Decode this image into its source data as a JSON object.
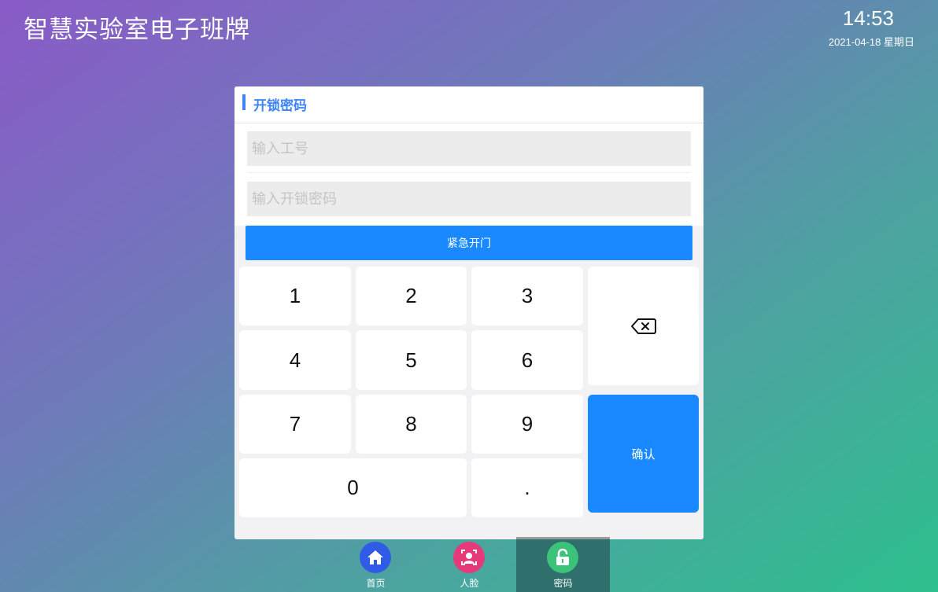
{
  "header": {
    "app_title": "智慧实验室电子班牌",
    "time": "14:53",
    "date": "2021-04-18 星期日"
  },
  "panel": {
    "title": "开锁密码",
    "employee_id_placeholder": "输入工号",
    "password_placeholder": "输入开锁密码",
    "emergency_label": "紧急开门"
  },
  "keypad": {
    "k1": "1",
    "k2": "2",
    "k3": "3",
    "k4": "4",
    "k5": "5",
    "k6": "6",
    "k7": "7",
    "k8": "8",
    "k9": "9",
    "k0": "0",
    "dot": ".",
    "backspace_icon": "backspace-icon",
    "confirm_label": "确认"
  },
  "nav": [
    {
      "label": "首页",
      "icon": "home-icon",
      "color": "#2f5be6",
      "active": false
    },
    {
      "label": "人脸",
      "icon": "face-icon",
      "color": "#e6397a",
      "active": false
    },
    {
      "label": "密码",
      "icon": "unlock-icon",
      "color": "#3cc37a",
      "active": true
    }
  ],
  "colors": {
    "accent": "#1a89ff",
    "title_blue": "#3f86f5"
  }
}
